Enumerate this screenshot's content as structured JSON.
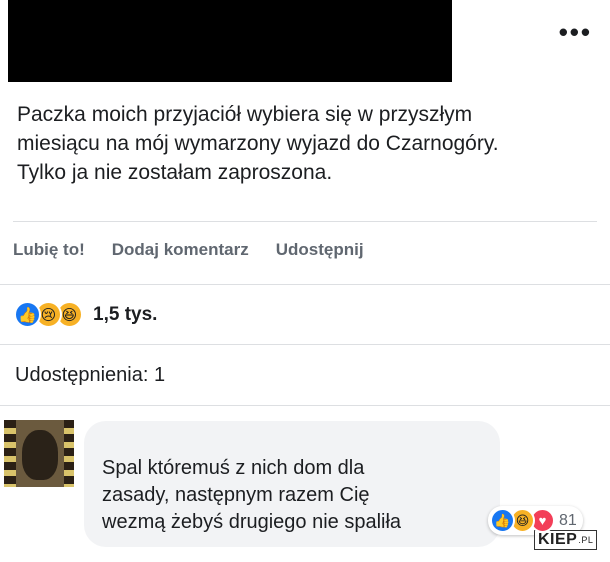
{
  "post": {
    "more_icon": "more-dots-icon",
    "text_lines": [
      "Paczka moich przyjaciół wybiera się w przyszłym",
      "miesiącu na mój wymarzony wyjazd do Czarnogóry.",
      "Tylko ja nie zostałam zaproszona."
    ]
  },
  "actions": {
    "like": "Lubię to!",
    "comment": "Dodaj komentarz",
    "share": "Udostępnij"
  },
  "reactions": {
    "icons": [
      "like-icon",
      "sad-icon",
      "haha-icon"
    ],
    "glyphs": {
      "like": "👍",
      "sad": "😢",
      "haha": "😆"
    },
    "count": "1,5 tys."
  },
  "shares_text": "Udostępnienia: 1",
  "comment": {
    "text_lines": [
      "Spal któremuś z nich dom dla",
      "zasady, następnym razem Cię",
      "wezmą żebyś drugiego nie spaliła"
    ],
    "reactions": {
      "icons": [
        "like-icon",
        "haha-icon",
        "love-icon"
      ],
      "glyphs": {
        "like": "👍",
        "haha": "😆",
        "love": "♥"
      },
      "count": "81"
    }
  },
  "watermark": {
    "main": "KIEP",
    "suffix": ".PL"
  },
  "colors": {
    "like_blue": "#1877f2",
    "reaction_yellow": "#f7b125",
    "love_red": "#f33e58",
    "muted_text": "#606770"
  }
}
